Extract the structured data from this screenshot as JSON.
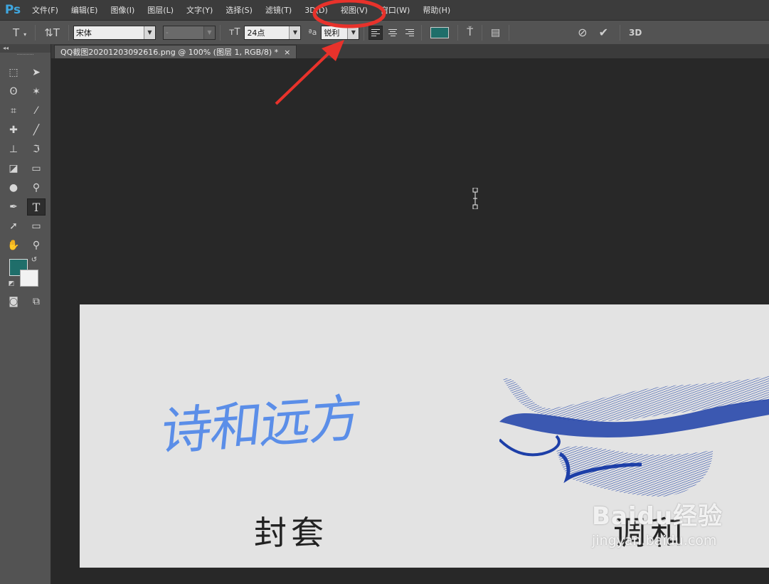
{
  "app": {
    "logo": "Ps"
  },
  "menu": [
    "文件(F)",
    "编辑(E)",
    "图像(I)",
    "图层(L)",
    "文字(Y)",
    "选择(S)",
    "滤镜(T)",
    "3D(D)",
    "视图(V)",
    "窗口(W)",
    "帮助(H)"
  ],
  "options": {
    "font_family": "宋体",
    "font_style": "-",
    "font_size": "24点",
    "antialias": "锐利",
    "aa_label": "ªa",
    "color": "#1f6e6a",
    "three_d_label": "3D"
  },
  "document_tab": {
    "title": "QQ截图20201203092616.png @ 100% (图层 1, RGB/8) *",
    "close": "×"
  },
  "toolbox": {
    "collapse": "◂◂",
    "fg_color": "#1f6e6a",
    "bg_color": "#f2f2f2"
  },
  "canvas": {
    "title_text": "诗和远方",
    "subtitle_left": "封套",
    "subtitle_right": "调和",
    "watermark_main": "Baidu经验",
    "watermark_sub": "jingyan.baidu.com"
  },
  "annotation": {
    "highlight_color": "#e8322b"
  }
}
